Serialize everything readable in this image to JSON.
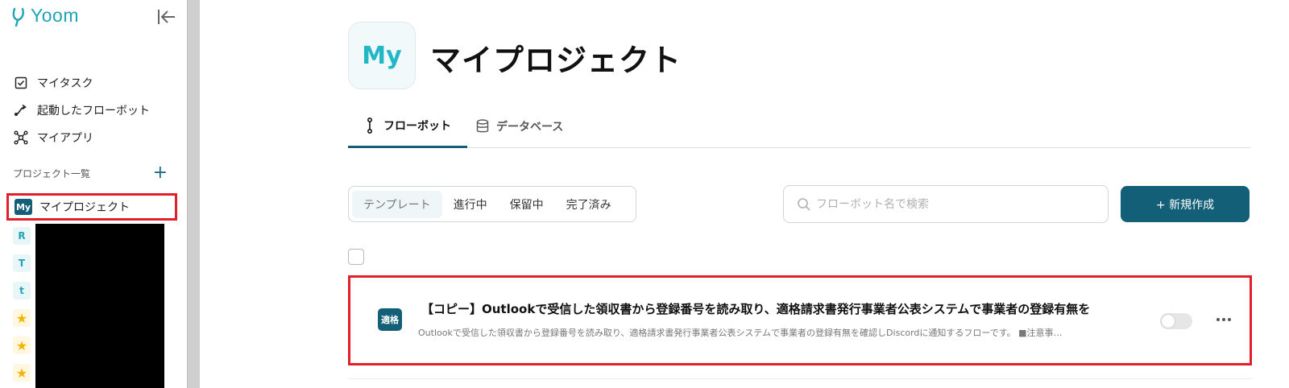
{
  "logo": {
    "text": "Yoom"
  },
  "nav": {
    "items": [
      {
        "label": "マイタスク",
        "icon": "checkbox-icon"
      },
      {
        "label": "起動したフローボット",
        "icon": "flow-arrow-icon"
      },
      {
        "label": "マイアプリ",
        "icon": "app-network-icon"
      }
    ]
  },
  "projects": {
    "header": "プロジェクト一覧",
    "active": {
      "badge": "My",
      "label": "マイプロジェクト"
    },
    "mini": [
      "R",
      "T",
      "t"
    ]
  },
  "page": {
    "icon_text": "My",
    "title": "マイプロジェクト"
  },
  "tabs": {
    "flowbot": "フローボット",
    "database": "データベース"
  },
  "filters": [
    "テンプレート",
    "進行中",
    "保留中",
    "完了済み"
  ],
  "search": {
    "placeholder": "フローボット名で検索"
  },
  "new_button": "+ 新規作成",
  "flow": {
    "icon_text": "適格",
    "title": "【コピー】Outlookで受信した領収書から登録番号を読み取り、適格請求書発行事業者公表システムで事業者の登録有無を",
    "description": "Outlookで受信した領収書から登録番号を読み取り、適格請求書発行事業者公表システムで事業者の登録有無を確認しDiscordに通知するフローです。 ■注意事…",
    "enabled": false
  },
  "colors": {
    "brand": "#135f78",
    "accent": "#1fa3b8",
    "highlight": "#e0202a"
  }
}
